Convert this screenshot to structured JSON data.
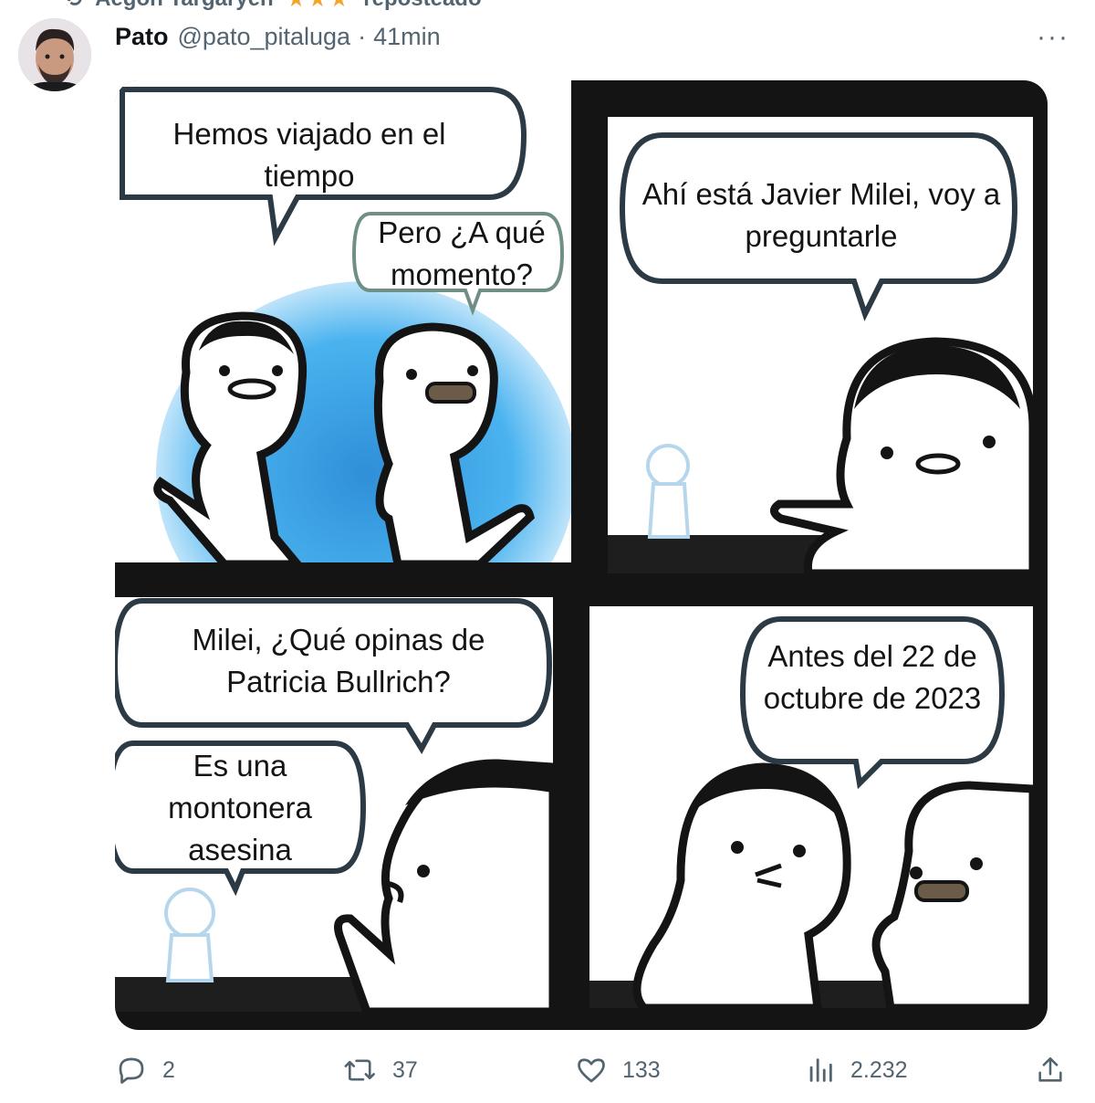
{
  "repost": {
    "label": "Aegon Targaryen",
    "stars": "★★★",
    "suffix": "reposteado"
  },
  "tweet": {
    "author_name": "Pato",
    "handle": "@pato_pitaluga",
    "separator": "·",
    "time": "41min",
    "more_label": "···"
  },
  "comic": {
    "panel1": {
      "bubble1": "Hemos viajado en el tiempo",
      "bubble2": "Pero ¿A qué momento?"
    },
    "panel2": {
      "bubble1": "Ahí está Javier Milei, voy a preguntarle"
    },
    "panel3": {
      "bubble1": "Milei, ¿Qué opinas de Patricia Bullrich?",
      "bubble2": "Es una montonera asesina"
    },
    "panel4": {
      "bubble1": "Antes del 22 de octubre de 2023"
    }
  },
  "actions": {
    "replies": "2",
    "reposts": "37",
    "likes": "133",
    "views": "2.232"
  },
  "colors": {
    "secondary_text": "#536471",
    "portal_blue": "#3aa3e6",
    "star": "#f4a62a"
  }
}
